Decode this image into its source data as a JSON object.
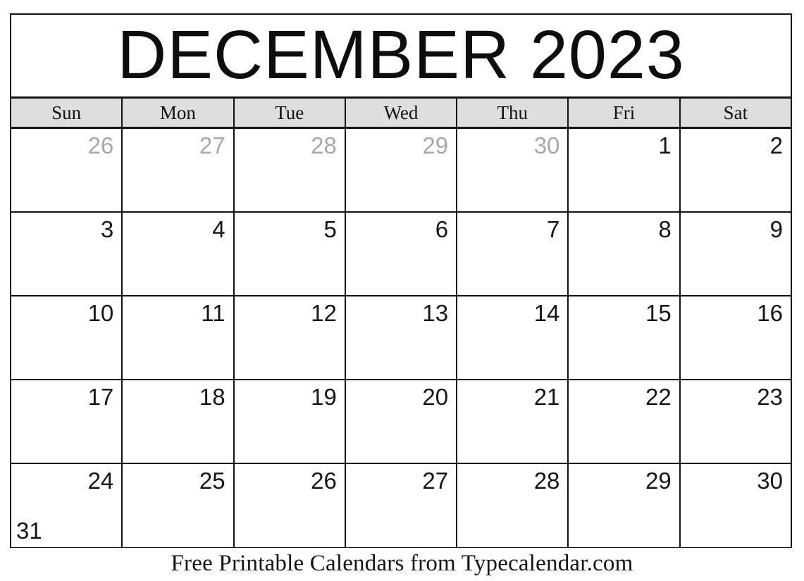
{
  "calendar": {
    "title": "DECEMBER 2023",
    "month_name": "DECEMBER",
    "year": "2023",
    "weekday_headers": [
      {
        "label": "Sun"
      },
      {
        "label": "Mon"
      },
      {
        "label": "Tue"
      },
      {
        "label": "Wed"
      },
      {
        "label": "Thu"
      },
      {
        "label": "Fri"
      },
      {
        "label": "Sat"
      }
    ],
    "weeks": [
      {
        "days": [
          {
            "number": "26",
            "outside": true
          },
          {
            "number": "27",
            "outside": true
          },
          {
            "number": "28",
            "outside": true
          },
          {
            "number": "29",
            "outside": true
          },
          {
            "number": "30",
            "outside": true
          },
          {
            "number": "1",
            "outside": false
          },
          {
            "number": "2",
            "outside": false
          }
        ]
      },
      {
        "days": [
          {
            "number": "3",
            "outside": false
          },
          {
            "number": "4",
            "outside": false
          },
          {
            "number": "5",
            "outside": false
          },
          {
            "number": "6",
            "outside": false
          },
          {
            "number": "7",
            "outside": false
          },
          {
            "number": "8",
            "outside": false
          },
          {
            "number": "9",
            "outside": false
          }
        ]
      },
      {
        "days": [
          {
            "number": "10",
            "outside": false
          },
          {
            "number": "11",
            "outside": false
          },
          {
            "number": "12",
            "outside": false
          },
          {
            "number": "13",
            "outside": false
          },
          {
            "number": "14",
            "outside": false
          },
          {
            "number": "15",
            "outside": false
          },
          {
            "number": "16",
            "outside": false
          }
        ]
      },
      {
        "days": [
          {
            "number": "17",
            "outside": false
          },
          {
            "number": "18",
            "outside": false
          },
          {
            "number": "19",
            "outside": false
          },
          {
            "number": "20",
            "outside": false
          },
          {
            "number": "21",
            "outside": false
          },
          {
            "number": "22",
            "outside": false
          },
          {
            "number": "23",
            "outside": false
          }
        ]
      },
      {
        "days": [
          {
            "number": "24",
            "outside": false,
            "overflow_number": "31"
          },
          {
            "number": "25",
            "outside": false
          },
          {
            "number": "26",
            "outside": false
          },
          {
            "number": "27",
            "outside": false
          },
          {
            "number": "28",
            "outside": false
          },
          {
            "number": "29",
            "outside": false
          },
          {
            "number": "30",
            "outside": false
          }
        ]
      }
    ]
  },
  "footer": {
    "text": "Free Printable Calendars from Typecalendar.com"
  },
  "colors": {
    "border": "#141414",
    "header_background": "#dedede",
    "text": "#151515",
    "outside_day_text": "#a8a8a8",
    "page_background": "#ffffff"
  }
}
